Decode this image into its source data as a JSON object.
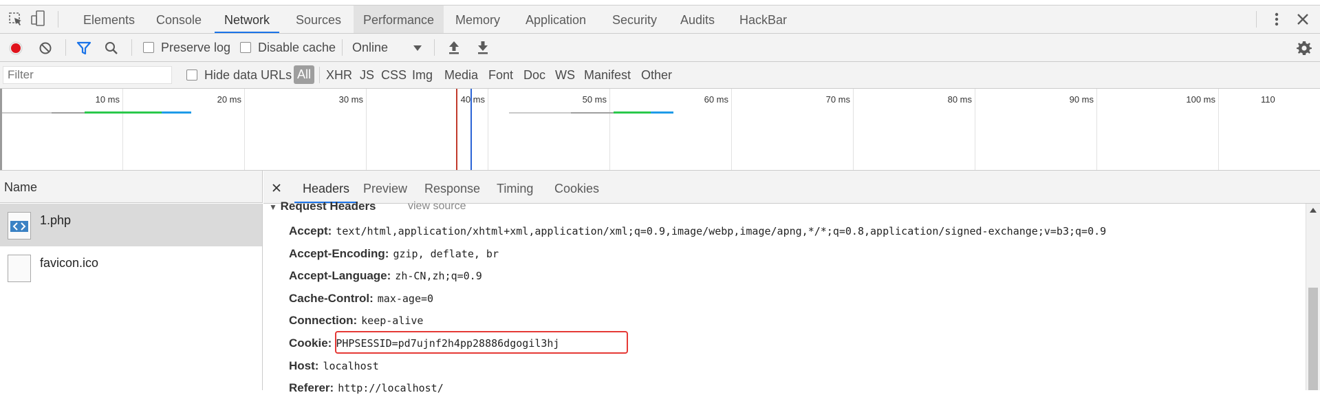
{
  "tabs": [
    {
      "label": "Elements"
    },
    {
      "label": "Console"
    },
    {
      "label": "Network"
    },
    {
      "label": "Sources"
    },
    {
      "label": "Performance"
    },
    {
      "label": "Memory"
    },
    {
      "label": "Application"
    },
    {
      "label": "Security"
    },
    {
      "label": "Audits"
    },
    {
      "label": "HackBar"
    }
  ],
  "toolbar": {
    "preserve_log": "Preserve log",
    "disable_cache": "Disable cache",
    "throttle": "Online"
  },
  "filterbar": {
    "filter_placeholder": "Filter",
    "hide_data_urls": "Hide data URLs",
    "types": [
      "All",
      "XHR",
      "JS",
      "CSS",
      "Img",
      "Media",
      "Font",
      "Doc",
      "WS",
      "Manifest",
      "Other"
    ]
  },
  "timeline": {
    "ticks": [
      "10 ms",
      "20 ms",
      "30 ms",
      "40 ms",
      "50 ms",
      "60 ms",
      "70 ms",
      "80 ms",
      "90 ms",
      "100 ms",
      "110"
    ]
  },
  "request_list": {
    "header": "Name",
    "items": [
      {
        "name": "1.php"
      },
      {
        "name": "favicon.ico"
      }
    ]
  },
  "detail_tabs": [
    "Headers",
    "Preview",
    "Response",
    "Timing",
    "Cookies"
  ],
  "request_headers": {
    "title": "Request Headers",
    "view_source": "view source",
    "rows": [
      {
        "key": "Accept:",
        "value": "text/html,application/xhtml+xml,application/xml;q=0.9,image/webp,image/apng,*/*;q=0.8,application/signed-exchange;v=b3;q=0.9"
      },
      {
        "key": "Accept-Encoding:",
        "value": "gzip, deflate, br"
      },
      {
        "key": "Accept-Language:",
        "value": "zh-CN,zh;q=0.9"
      },
      {
        "key": "Cache-Control:",
        "value": "max-age=0"
      },
      {
        "key": "Connection:",
        "value": "keep-alive"
      },
      {
        "key": "Cookie:",
        "value": "PHPSESSID=pd7ujnf2h4pp28886dgogil3hj"
      },
      {
        "key": "Host:",
        "value": "localhost"
      },
      {
        "key": "Referer:",
        "value": "http://localhost/"
      }
    ]
  },
  "colors": {
    "accent": "#1a73e8",
    "record": "#e0121b",
    "highlight_box": "#e53935",
    "dcl_line": "#2a63d6",
    "load_line": "#c0392b"
  }
}
